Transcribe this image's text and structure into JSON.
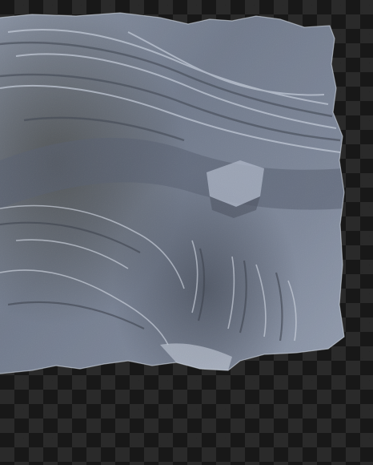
{
  "image": {
    "subject": "rock-slab",
    "background": "transparency-checkerboard",
    "colors": {
      "checker_dark": "#181818",
      "checker_light": "#2a2a2a",
      "rock_base": "#6b7485",
      "rock_highlight": "#c9d2e0",
      "rock_shadow": "#2c313b"
    }
  }
}
